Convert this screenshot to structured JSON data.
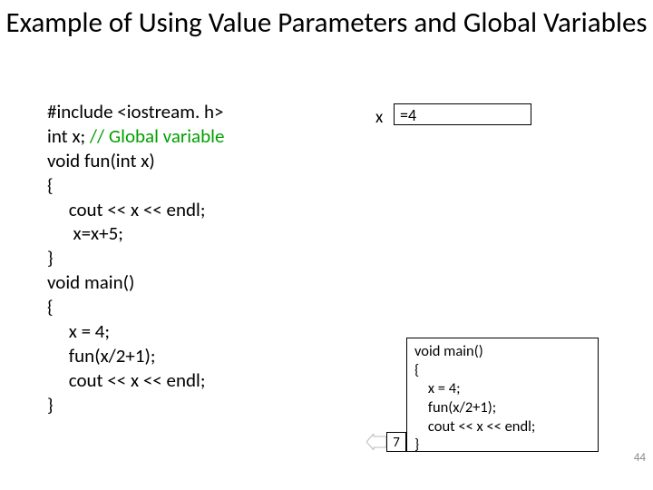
{
  "title": "Example of Using Value Parameters and Global Variables",
  "code": {
    "l1": "#include <iostream. h>",
    "l2a": "int x; ",
    "l2b": "// Global variable",
    "l3": "void fun(int x)",
    "l4": "{",
    "l5": "     cout << x << endl;",
    "l6": "      x=x+5;",
    "l7": "}",
    "l8": "void main()",
    "l9": "{",
    "l10": "     x = 4;",
    "l11": "     fun(x/2+1);",
    "l12": "     cout << x << endl;",
    "l13": "}"
  },
  "trace": {
    "x_label": "x",
    "x_value": "=4",
    "seven": "7",
    "main": {
      "l1": "void main()",
      "l2": "{",
      "l3": "    x = 4;",
      "l4": "    fun(x/2+1);",
      "l5": "    cout << x << endl;",
      "l6": "}"
    }
  },
  "page_number": "44"
}
